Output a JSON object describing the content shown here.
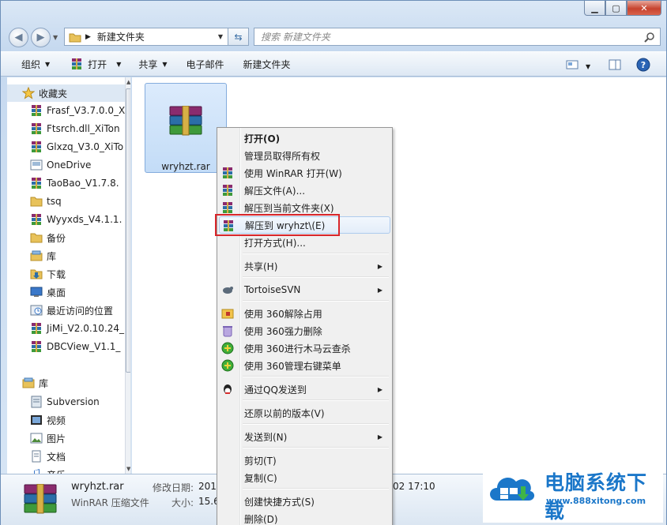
{
  "window": {
    "caption_buttons": [
      "minimize",
      "maximize",
      "close"
    ]
  },
  "address": {
    "path": "新建文件夹",
    "search_placeholder": "搜索 新建文件夹"
  },
  "toolbar": {
    "organize": "组织",
    "open": "打开",
    "share": "共享",
    "email": "电子邮件",
    "new_folder": "新建文件夹"
  },
  "nav": {
    "favorites": "收藏夹",
    "items": [
      {
        "label": "Frasf_V3.7.0.0_X",
        "icon": "rar-icon"
      },
      {
        "label": "Ftsrch.dll_XiTon",
        "icon": "rar-icon"
      },
      {
        "label": "Glxzq_V3.0_XiTo",
        "icon": "rar-icon"
      },
      {
        "label": "OneDrive",
        "icon": "onedrive-icon"
      },
      {
        "label": "TaoBao_V1.7.8.",
        "icon": "rar-icon"
      },
      {
        "label": "tsq",
        "icon": "folder-icon"
      },
      {
        "label": "Wyyxds_V4.1.1.",
        "icon": "rar-icon"
      },
      {
        "label": "备份",
        "icon": "folder-icon"
      },
      {
        "label": "库",
        "icon": "library-icon"
      },
      {
        "label": "下载",
        "icon": "download-folder-icon"
      },
      {
        "label": "桌面",
        "icon": "desktop-icon"
      },
      {
        "label": "最近访问的位置",
        "icon": "recent-icon"
      },
      {
        "label": "JiMi_V2.0.10.24_",
        "icon": "rar-icon"
      },
      {
        "label": "DBCView_V1.1_",
        "icon": "rar-icon"
      }
    ],
    "library": "库",
    "library_items": [
      {
        "label": "Subversion",
        "icon": "svn-icon"
      },
      {
        "label": "视频",
        "icon": "video-icon"
      },
      {
        "label": "图片",
        "icon": "picture-icon"
      },
      {
        "label": "文档",
        "icon": "document-icon"
      },
      {
        "label": "音乐",
        "icon": "music-icon"
      }
    ]
  },
  "file": {
    "name": "wryhzt.rar"
  },
  "details": {
    "name": "wryhzt.rar",
    "type": "WinRAR 压缩文件",
    "modified_label": "修改日期:",
    "modified_value_start": "2018",
    "modified_value_end": "02 17:10",
    "size_label": "大小:",
    "size_value": "15.6"
  },
  "context_menu": {
    "items": [
      {
        "label": "打开(O)",
        "bold": true,
        "icon": ""
      },
      {
        "label": "管理员取得所有权",
        "icon": ""
      },
      {
        "label": "使用 WinRAR 打开(W)",
        "icon": "rar-icon"
      },
      {
        "label": "解压文件(A)...",
        "icon": "rar-icon"
      },
      {
        "label": "解压到当前文件夹(X)",
        "icon": "rar-icon"
      },
      {
        "label": "解压到 wryhzt\\(E)",
        "icon": "rar-icon",
        "highlighted": true
      },
      {
        "label": "打开方式(H)...",
        "icon": ""
      },
      {
        "label": "共享(H)",
        "icon": "",
        "submenu": true
      },
      {
        "label": "TortoiseSVN",
        "icon": "tortoise-icon",
        "submenu": true
      },
      {
        "label": "使用 360解除占用",
        "icon": "360-unlock-icon"
      },
      {
        "label": "使用 360强力删除",
        "icon": "360-delete-icon"
      },
      {
        "label": "使用 360进行木马云查杀",
        "icon": "360-scan-icon"
      },
      {
        "label": "使用 360管理右键菜单",
        "icon": "360-manage-icon"
      },
      {
        "label": "通过QQ发送到",
        "icon": "qq-icon",
        "submenu": true
      },
      {
        "label": "还原以前的版本(V)",
        "icon": ""
      },
      {
        "label": "发送到(N)",
        "icon": "",
        "submenu": true
      },
      {
        "label": "剪切(T)",
        "icon": ""
      },
      {
        "label": "复制(C)",
        "icon": ""
      },
      {
        "label": "创建快捷方式(S)",
        "icon": ""
      },
      {
        "label": "删除(D)",
        "icon": ""
      }
    ]
  },
  "watermark": {
    "title": "电脑系统下载",
    "url": "www.888xitong.com"
  },
  "colors": {
    "highlight_box": "#d8262b",
    "watermark_blue": "#1b77c9"
  }
}
